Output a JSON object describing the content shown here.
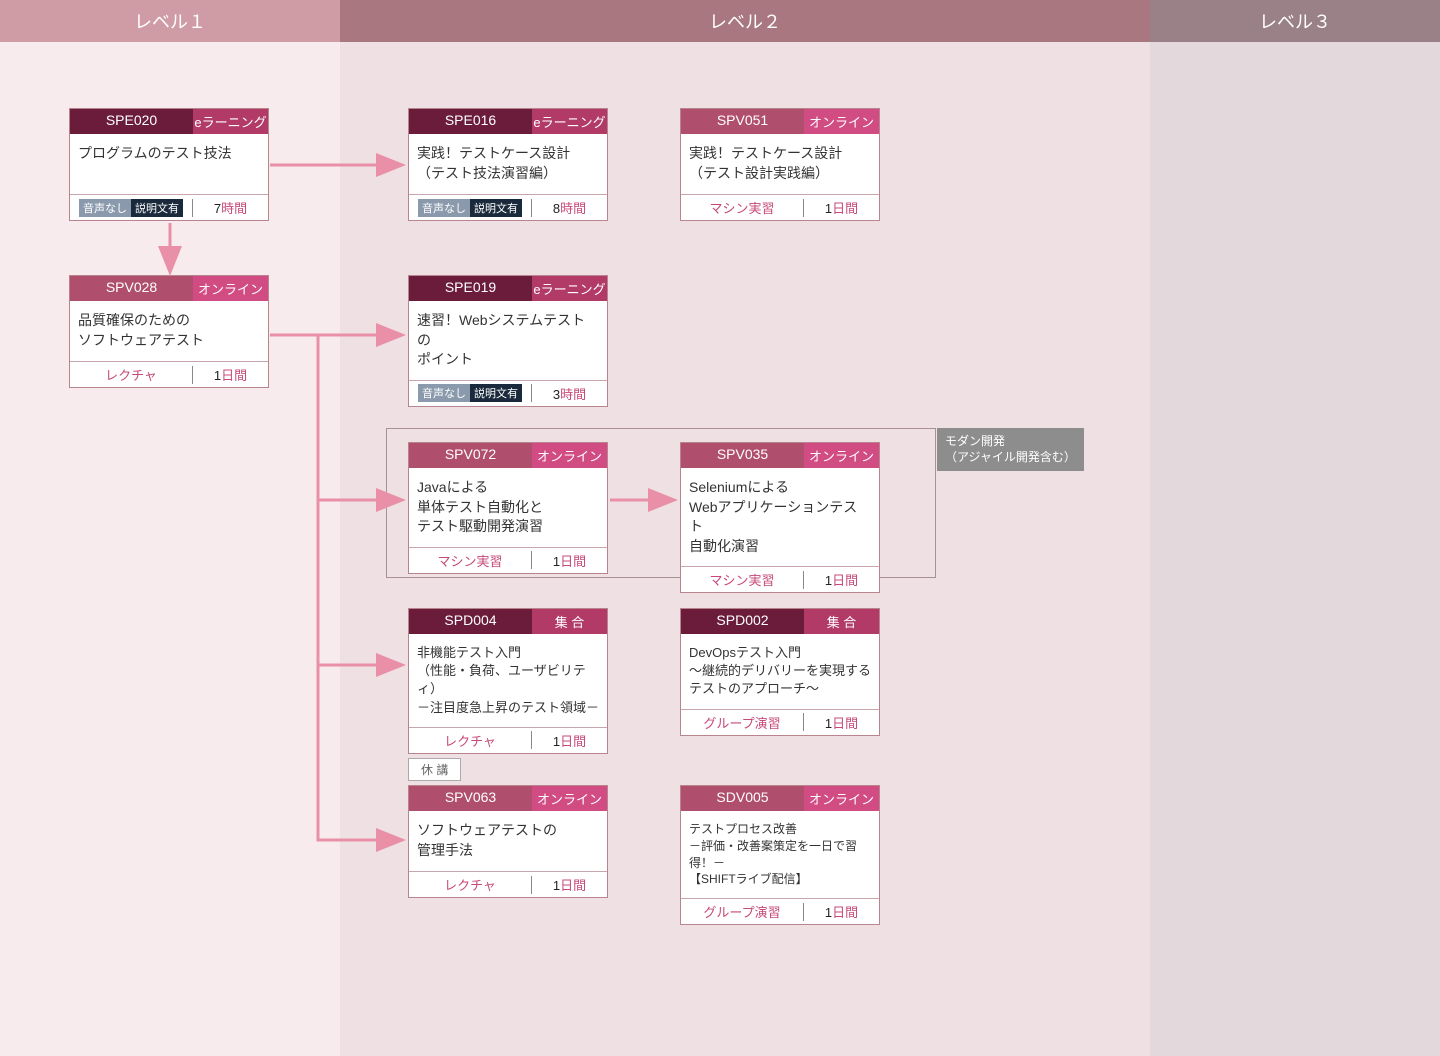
{
  "levels": {
    "l1": "レベル１",
    "l2": "レベル２",
    "l3": "レベル３"
  },
  "suspend_label": "休 講",
  "group": {
    "label_line1": "モダン開発",
    "label_line2": "（アジャイル開発含む）"
  },
  "cards": {
    "spe020": {
      "code": "SPE020",
      "tag": "eラーニング",
      "title": "プログラムのテスト技法",
      "foot_audio_a": "音声なし",
      "foot_audio_b": "説明文有",
      "dur_num": "7",
      "dur_unit": "時間"
    },
    "spv028": {
      "code": "SPV028",
      "tag": "オンライン",
      "title_l1": "品質確保のための",
      "title_l2": "ソフトウェアテスト",
      "foot_type": "レクチャ",
      "dur_num": "1",
      "dur_unit": "日間"
    },
    "spe016": {
      "code": "SPE016",
      "tag": "eラーニング",
      "title_l1": "実践！テストケース設計",
      "title_l2": "（テスト技法演習編）",
      "foot_audio_a": "音声なし",
      "foot_audio_b": "説明文有",
      "dur_num": "8",
      "dur_unit": "時間"
    },
    "spv051": {
      "code": "SPV051",
      "tag": "オンライン",
      "title_l1": "実践！テストケース設計",
      "title_l2": "（テスト設計実践編）",
      "foot_type": "マシン実習",
      "dur_num": "1",
      "dur_unit": "日間"
    },
    "spe019": {
      "code": "SPE019",
      "tag": "eラーニング",
      "title_l1": "速習！Webシステムテストの",
      "title_l2": "ポイント",
      "foot_audio_a": "音声なし",
      "foot_audio_b": "説明文有",
      "dur_num": "3",
      "dur_unit": "時間"
    },
    "spv072": {
      "code": "SPV072",
      "tag": "オンライン",
      "title_l1": "Javaによる",
      "title_l2": "単体テスト自動化と",
      "title_l3": "テスト駆動開発演習",
      "foot_type": "マシン実習",
      "dur_num": "1",
      "dur_unit": "日間"
    },
    "spv035": {
      "code": "SPV035",
      "tag": "オンライン",
      "title_l1": "Seleniumによる",
      "title_l2": "Webアプリケーションテスト",
      "title_l3": "自動化演習",
      "foot_type": "マシン実習",
      "dur_num": "1",
      "dur_unit": "日間"
    },
    "spd004": {
      "code": "SPD004",
      "tag": "集 合",
      "title_l1": "非機能テスト入門",
      "title_l2": "（性能・負荷、ユーザビリティ）",
      "title_l3": "－注目度急上昇のテスト領域－",
      "foot_type": "レクチャ",
      "dur_num": "1",
      "dur_unit": "日間"
    },
    "spd002": {
      "code": "SPD002",
      "tag": "集 合",
      "title_l1": "DevOpsテスト入門",
      "title_l2": "～継続的デリバリーを実現する",
      "title_l3": "テストのアプローチ～",
      "foot_type": "グループ演習",
      "dur_num": "1",
      "dur_unit": "日間"
    },
    "spv063": {
      "code": "SPV063",
      "tag": "オンライン",
      "title_l1": "ソフトウェアテストの",
      "title_l2": "管理手法",
      "foot_type": "レクチャ",
      "dur_num": "1",
      "dur_unit": "日間"
    },
    "sdv005": {
      "code": "SDV005",
      "tag": "オンライン",
      "title_l1": "テストプロセス改善",
      "title_l2": "－評価・改善案策定を一日で習得！－",
      "title_l3": "【SHIFTライブ配信】",
      "foot_type": "グループ演習",
      "dur_num": "1",
      "dur_unit": "日間"
    }
  }
}
